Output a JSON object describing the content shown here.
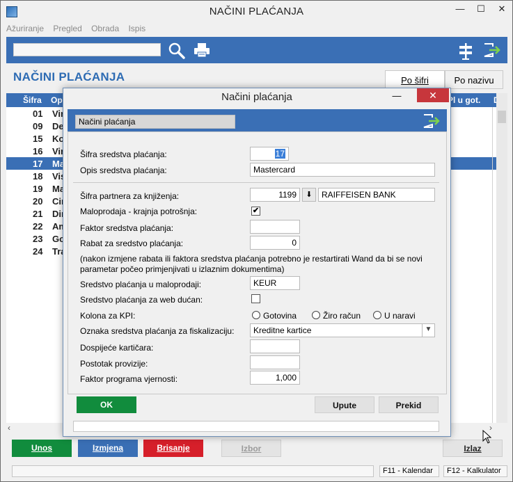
{
  "window": {
    "title": "NAČINI PLAĆANJA",
    "min": "—",
    "max": "☐",
    "close": "✕"
  },
  "menu": [
    "Ažuriranje",
    "Pregled",
    "Obrada",
    "Ispis"
  ],
  "page": {
    "title": "NAČINI PLAĆANJA"
  },
  "sort_tabs": {
    "by_code": "Po šifri",
    "by_name": "Po nazivu"
  },
  "table": {
    "headers": {
      "code": "Šifra",
      "name": "Op",
      "cash": "Pl u got.",
      "last": "D"
    },
    "rows": [
      {
        "code": "01",
        "name": "Vir"
      },
      {
        "code": "09",
        "name": "De"
      },
      {
        "code": "15",
        "name": "Ko"
      },
      {
        "code": "16",
        "name": "Vir"
      },
      {
        "code": "17",
        "name": "Ma"
      },
      {
        "code": "18",
        "name": "Vis"
      },
      {
        "code": "19",
        "name": "Ma"
      },
      {
        "code": "20",
        "name": "Cir"
      },
      {
        "code": "21",
        "name": "Dir"
      },
      {
        "code": "22",
        "name": "Am"
      },
      {
        "code": "23",
        "name": "Go"
      },
      {
        "code": "24",
        "name": "Tra"
      }
    ],
    "selected_index": 4
  },
  "actions": {
    "unos": "Unos",
    "izmjena": "Izmjena",
    "brisanje": "Brisanje",
    "izbor": "Izbor",
    "izlaz": "Izlaz"
  },
  "status": {
    "f11": "F11 - Kalendar",
    "f12": "F12 - Kalkulator"
  },
  "dialog": {
    "title": "Načini plaćanja",
    "caption": "Načini plaćanja",
    "fields": {
      "code_label": "Šifra sredstva plaćanja:",
      "code_value": "17",
      "desc_label": "Opis sredstva plaćanja:",
      "desc_value": "Mastercard",
      "partner_label": "Šifra partnera za knjiženja:",
      "partner_code": "1199",
      "partner_name": "RAIFFEISEN BANK",
      "retail_label": "Maloprodaja - krajnja potrošnja:",
      "retail_checked": "✔",
      "factor_label": "Faktor sredstva plaćanja:",
      "factor_value": "",
      "discount_label": "Rabat za sredstvo plaćanja:",
      "discount_value": "0",
      "note": "(nakon izmjene rabata ili faktora sredstva plaćanja potrebno je restartirati Wand da bi se novi parametar počeo primjenjivati u izlaznim dokumentima)",
      "retail_code_label": "Sredstvo plaćanja u maloprodaji:",
      "retail_code_value": "KEUR",
      "web_label": "Sredstvo plaćanja za web dućan:",
      "kpi_label": "Kolona za KPI:",
      "kpi_options": [
        "Gotovina",
        "Žiro račun",
        "U naravi"
      ],
      "fiscal_label": "Oznaka sredstva plaćanja za fiskalizaciju:",
      "fiscal_value": "Kreditne kartice",
      "due_label": "Dospijeće kartičara:",
      "due_value": "",
      "commission_label": "Postotak provizije:",
      "commission_value": "",
      "loyalty_label": "Faktor programa vjernosti:",
      "loyalty_value": "1,000"
    },
    "buttons": {
      "ok": "OK",
      "upute": "Upute",
      "prekid": "Prekid"
    }
  },
  "colors": {
    "accent": "#3a6fb5",
    "ok_green": "#118c3d",
    "delete_red": "#d61f2a",
    "title_blue": "#2d6bb3"
  }
}
